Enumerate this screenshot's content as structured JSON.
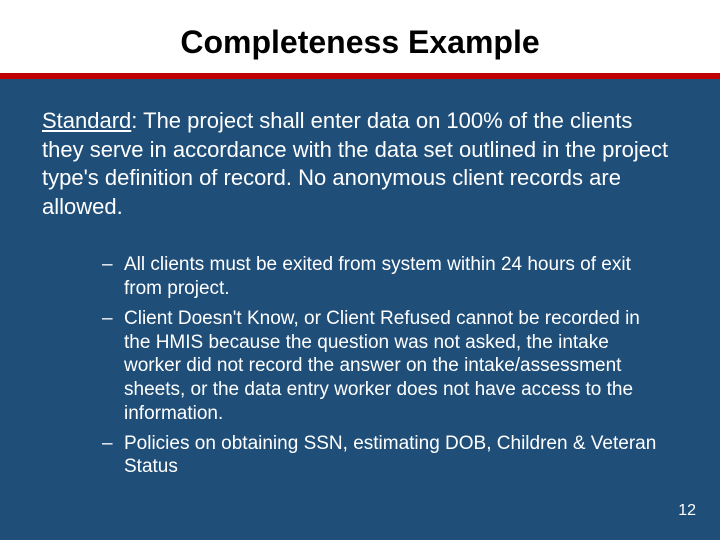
{
  "title": "Completeness Example",
  "standard": {
    "label": "Standard",
    "text": ": The project shall enter data on 100% of the clients they serve in accordance with the data set outlined in the project type's definition of record. No anonymous client records are allowed."
  },
  "bullets": [
    "All clients must be exited from system within 24 hours of exit from project.",
    "Client Doesn't Know, or Client Refused cannot be recorded in the HMIS because the question was not asked, the intake worker did not record the answer on the intake/assessment sheets, or the data entry worker does not have access to the information.",
    "Policies on obtaining SSN, estimating DOB, Children & Veteran Status"
  ],
  "pageNumber": "12"
}
